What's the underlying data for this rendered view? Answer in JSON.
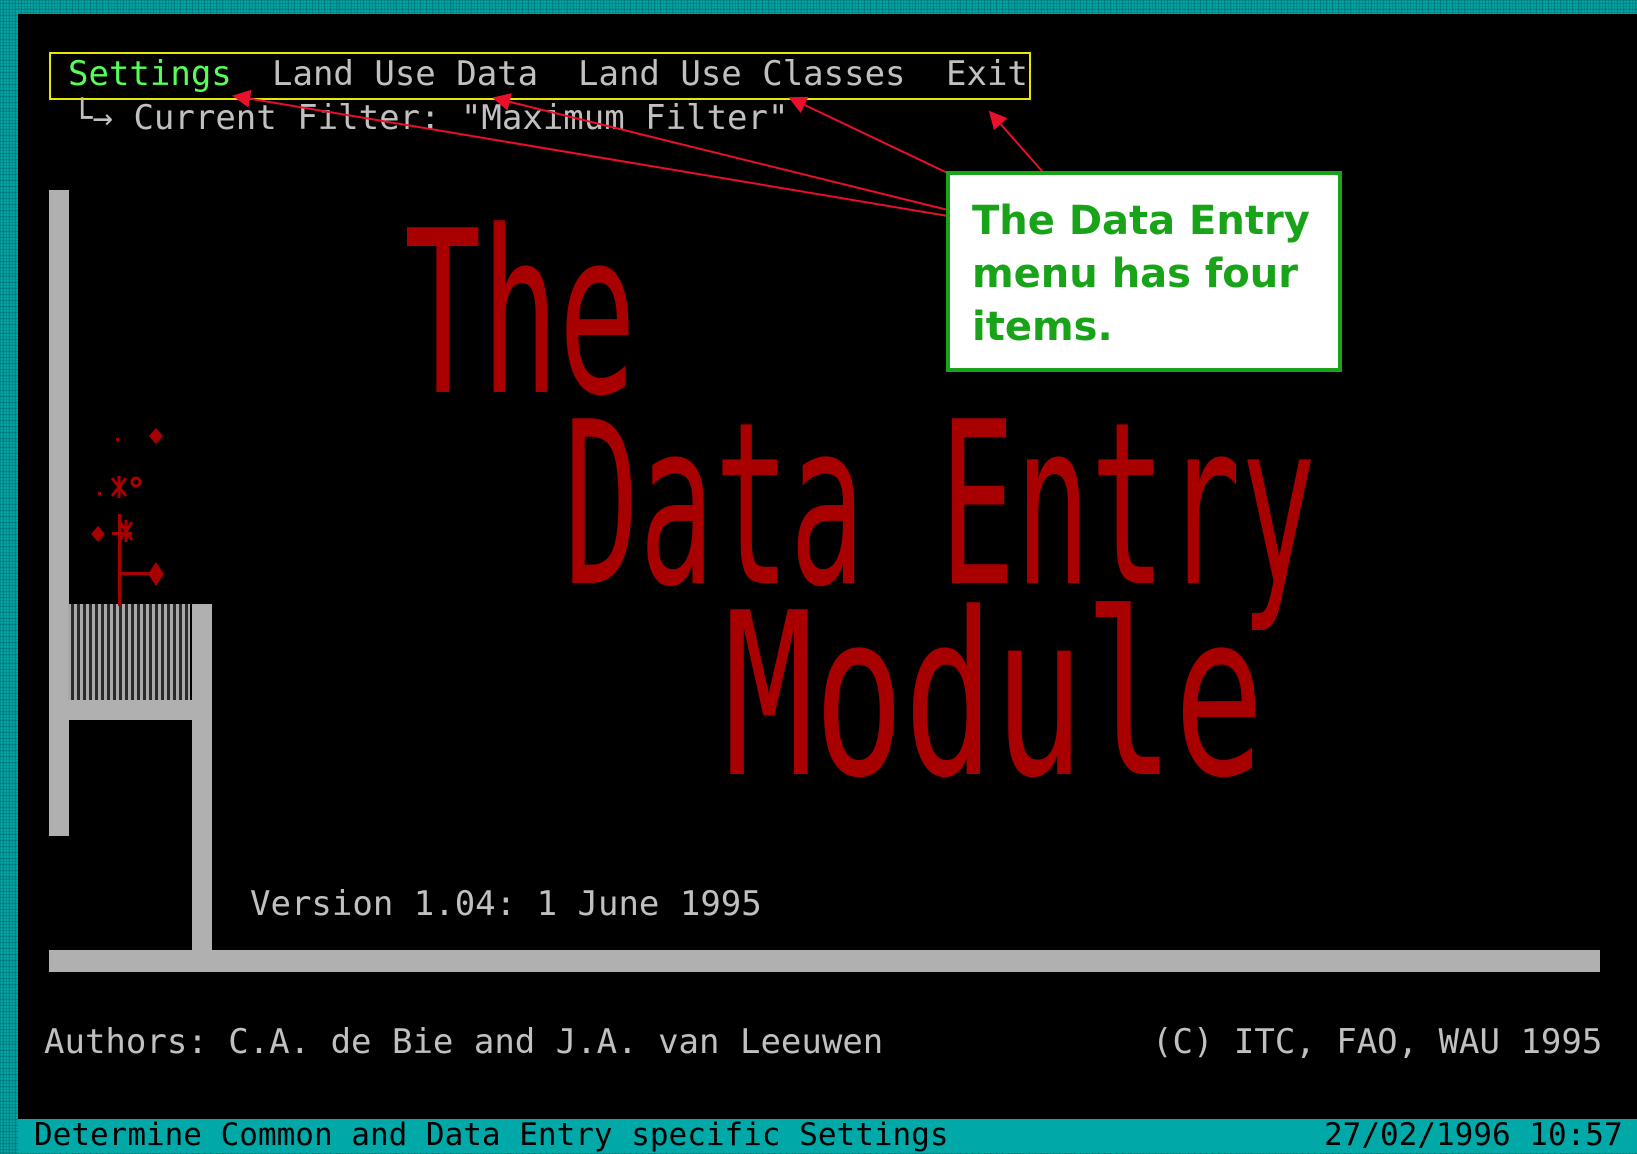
{
  "menu": {
    "items": [
      "Settings",
      "Land Use Data",
      "Land Use Classes",
      "Exit"
    ],
    "active_item": "Settings",
    "sub_indicator": "└→",
    "current_filter": "Current Filter: \"Maximum Filter\""
  },
  "splash": {
    "title_lines": [
      "The",
      "Data Entry",
      "Module"
    ],
    "version": "Version 1.04: 1 June 1995",
    "authors": "Authors: C.A. de Bie and J.A. van Leeuwen",
    "copyright": "(C) ITC, FAO, WAU 1995"
  },
  "status_bar": {
    "message": "Determine Common and Data Entry specific Settings",
    "datetime": "27/02/1996 10:57"
  },
  "annotation": {
    "callout_text": "The Data Entry menu has four items.",
    "colors": {
      "callout": "#19a319",
      "arrows": "#e8102a",
      "menubar_box": "#e8e800"
    }
  },
  "colors": {
    "background": "#000000",
    "desktop": "#00a8a8",
    "text": "#c0c0c0",
    "menu_active": "#55ff55",
    "title": "#a80000"
  },
  "icons": [
    "subitem-arrow-icon",
    "plant-pot-icon"
  ]
}
